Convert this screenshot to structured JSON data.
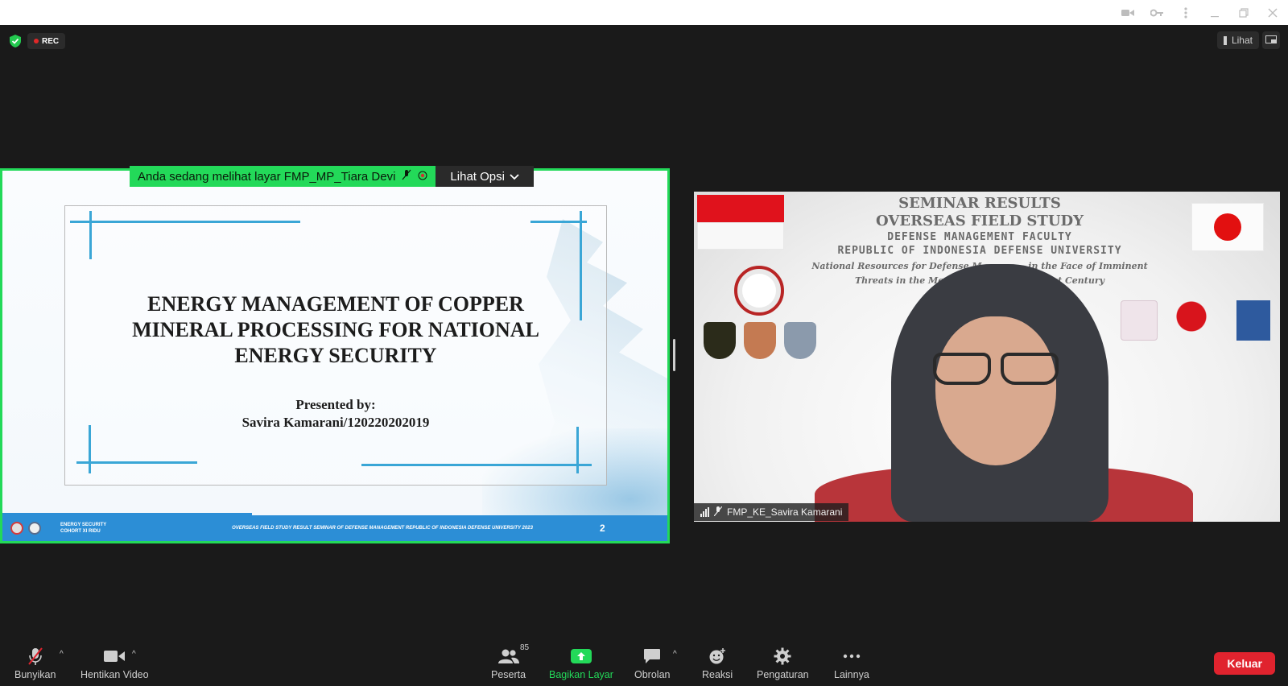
{
  "window": {
    "controls": [
      "camera-icon",
      "key-icon",
      "more-vertical-icon",
      "minimize-icon",
      "restore-icon",
      "close-icon"
    ]
  },
  "meeting": {
    "rec_label": "REC",
    "view_label": "Lihat"
  },
  "share_banner": {
    "viewing_text": "Anda sedang melihat layar FMP_MP_Tiara Devi",
    "options_label": "Lihat Opsi"
  },
  "slide": {
    "title_lines": [
      "ENERGY MANAGEMENT OF COPPER",
      "MINERAL PROCESSING FOR NATIONAL",
      "ENERGY SECURITY"
    ],
    "presented_by": "Presented by:",
    "presenter": "Savira Kamarani/120220202019",
    "footer_left_line1": "ENERGY SECURITY",
    "footer_left_line2": "COHORT XI RIDU",
    "footer_center": "OVERSEAS FIELD STUDY RESULT SEMINAR OF DEFENSE MANAGEMENT REPUBLIC OF INDONESIA DEFENSE UNIVERSITY 2023",
    "page_number": "2"
  },
  "speaker": {
    "bg_line1": "SEMINAR RESULTS",
    "bg_line2": "OVERSEAS FIELD STUDY",
    "bg_line3": "DEFENSE MANAGEMENT FACULTY",
    "bg_line4": "REPUBLIC OF INDONESIA DEFENSE UNIVERSITY",
    "bg_subtitle_1": "National Resources for Defense M",
    "bg_subtitle_1b": "in the Face of Imminent",
    "bg_subtitle_2": "Threats in the Mo",
    "bg_subtitle_2b": "1st Century",
    "name": "FMP_KE_Savira Kamarani"
  },
  "toolbar": {
    "unmute": "Bunyikan",
    "stop_video": "Hentikan Video",
    "participants": "Peserta",
    "participant_count": "85",
    "share_screen": "Bagikan Layar",
    "chat": "Obrolan",
    "reactions": "Reaksi",
    "settings": "Pengaturan",
    "more": "Lainnya",
    "leave": "Keluar"
  },
  "colors": {
    "share_border": "#23d959",
    "leave": "#e0232e",
    "slide_footer": "#2c8ed6",
    "slide_lines": "#3aa6d6"
  }
}
